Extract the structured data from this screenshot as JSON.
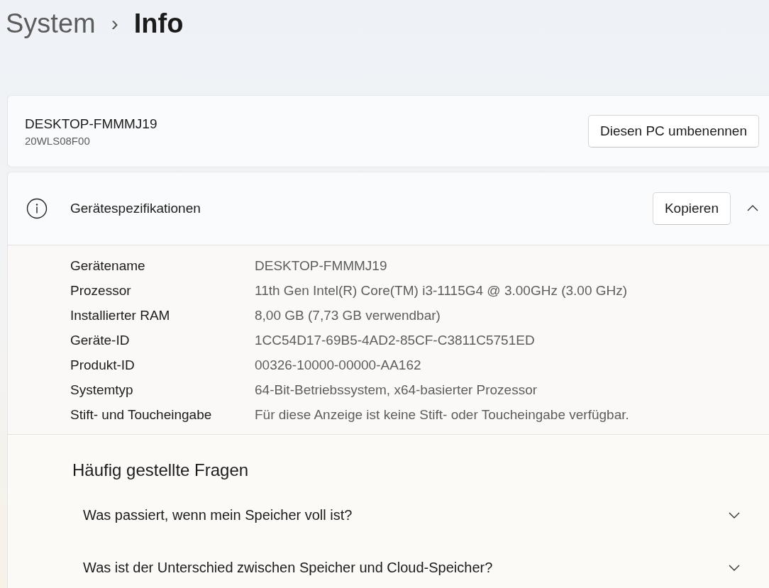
{
  "breadcrumb": {
    "parent": "System",
    "separator": "›",
    "current": "Info"
  },
  "device": {
    "name": "DESKTOP-FMMMJ19",
    "model": "20WLS08F00",
    "rename_button": "Diesen PC umbenennen"
  },
  "specs": {
    "title": "Gerätespezifikationen",
    "copy_button": "Kopieren",
    "expanded": true,
    "rows": [
      {
        "label": "Gerätename",
        "value": "DESKTOP-FMMMJ19"
      },
      {
        "label": "Prozessor",
        "value": "11th Gen Intel(R) Core(TM) i3-1115G4 @ 3.00GHz (3.00 GHz)"
      },
      {
        "label": "Installierter RAM",
        "value": "8,00 GB (7,73 GB verwendbar)"
      },
      {
        "label": "Geräte-ID",
        "value": "1CC54D17-69B5-4AD2-85CF-C3811C5751ED"
      },
      {
        "label": "Produkt-ID",
        "value": "00326-10000-00000-AA162"
      },
      {
        "label": "Systemtyp",
        "value": "64-Bit-Betriebssystem, x64-basierter Prozessor"
      },
      {
        "label": "Stift- und Toucheingabe",
        "value": "Für diese Anzeige ist keine Stift- oder Toucheingabe verfügbar."
      }
    ]
  },
  "faq": {
    "title": "Häufig gestellte Fragen",
    "items": [
      {
        "question": "Was passiert, wenn mein Speicher voll ist?",
        "expanded": false
      },
      {
        "question": "Was ist der Unterschied zwischen Speicher und Cloud-Speicher?",
        "expanded": false
      }
    ]
  }
}
